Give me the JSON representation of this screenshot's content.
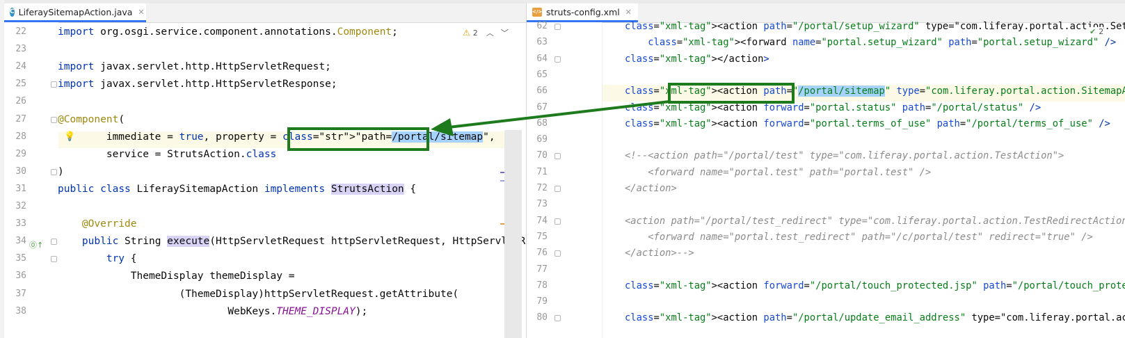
{
  "left_editor": {
    "tab": {
      "label": "LiferaySitemapAction.java",
      "icon": "class-icon"
    },
    "warnings": {
      "count": "2"
    },
    "lines": [
      {
        "n": "22",
        "text": "import org.osgi.service.component.annotations.Component;"
      },
      {
        "n": "23",
        "text": ""
      },
      {
        "n": "24",
        "text": "import javax.servlet.http.HttpServletRequest;"
      },
      {
        "n": "25",
        "text": "import javax.servlet.http.HttpServletResponse;"
      },
      {
        "n": "26",
        "text": ""
      },
      {
        "n": "27",
        "text": "@Component("
      },
      {
        "n": "28",
        "text": "        immediate = true, property = \"path=/portal/sitemap\","
      },
      {
        "n": "29",
        "text": "        service = StrutsAction.class"
      },
      {
        "n": "30",
        "text": ")"
      },
      {
        "n": "31",
        "text": "public class LiferaySitemapAction implements StrutsAction {"
      },
      {
        "n": "32",
        "text": ""
      },
      {
        "n": "33",
        "text": "    @Override"
      },
      {
        "n": "34",
        "text": "    public String execute(HttpServletRequest httpServletRequest, HttpServletR"
      },
      {
        "n": "35",
        "text": "        try {"
      },
      {
        "n": "36",
        "text": "            ThemeDisplay themeDisplay ="
      },
      {
        "n": "37",
        "text": "                    (ThemeDisplay)httpServletRequest.getAttribute("
      },
      {
        "n": "38",
        "text": "                            WebKeys.THEME_DISPLAY);"
      }
    ]
  },
  "right_editor": {
    "tab": {
      "label": "struts-config.xml",
      "icon": "xml-icon"
    },
    "checks": {
      "count": "2"
    },
    "lines": [
      {
        "n": "62",
        "text": "<action path=\"/portal/setup_wizard\" type=\"com.liferay.portal.action.SetupWizardActi"
      },
      {
        "n": "63",
        "text": "    <forward name=\"portal.setup_wizard\" path=\"portal.setup_wizard\" />"
      },
      {
        "n": "64",
        "text": "</action>"
      },
      {
        "n": "65",
        "text": ""
      },
      {
        "n": "66",
        "text": "<action path=\"/portal/sitemap\" type=\"com.liferay.portal.action.SitemapAction\" />"
      },
      {
        "n": "67",
        "text": "<action forward=\"portal.status\" path=\"/portal/status\" />"
      },
      {
        "n": "68",
        "text": "<action forward=\"portal.terms_of_use\" path=\"/portal/terms_of_use\" />"
      },
      {
        "n": "69",
        "text": ""
      },
      {
        "n": "70",
        "text": "<!--<action path=\"/portal/test\" type=\"com.liferay.portal.action.TestAction\">"
      },
      {
        "n": "71",
        "text": "    <forward name=\"portal.test\" path=\"portal.test\" />"
      },
      {
        "n": "72",
        "text": "</action>"
      },
      {
        "n": "73",
        "text": ""
      },
      {
        "n": "74",
        "text": "<action path=\"/portal/test_redirect\" type=\"com.liferay.portal.action.TestRedirectAction\">"
      },
      {
        "n": "75",
        "text": "    <forward name=\"portal.test_redirect\" path=\"/c/portal/test\" redirect=\"true\" />"
      },
      {
        "n": "76",
        "text": "</action>-->"
      },
      {
        "n": "77",
        "text": ""
      },
      {
        "n": "78",
        "text": "<action forward=\"/portal/touch_protected.jsp\" path=\"/portal/touch_protected\" />"
      },
      {
        "n": "79",
        "text": ""
      },
      {
        "n": "80",
        "text": "<action path=\"/portal/update_email_address\" type=\"com.liferay.portal.action.UpdateEmailAdd"
      }
    ]
  },
  "annotation": {
    "arrow_color": "#1d7a1d",
    "highlighted_value": "/portal/sitemap"
  }
}
